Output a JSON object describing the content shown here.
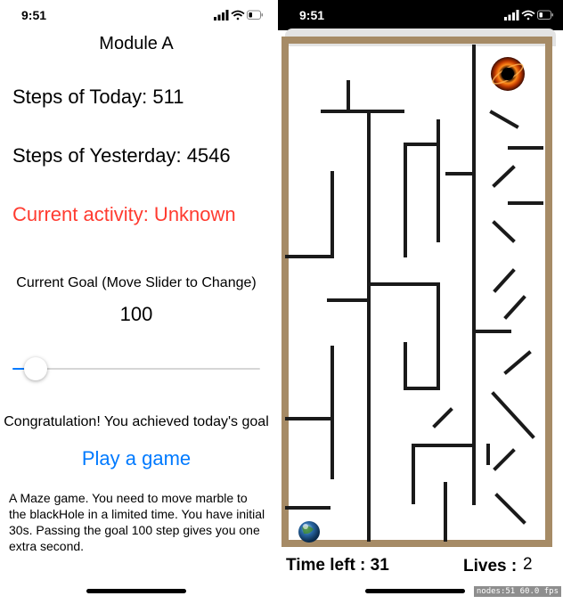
{
  "status_bar": {
    "time": "9:51"
  },
  "module": {
    "title": "Module A",
    "steps_today": "Steps of Today: 511",
    "steps_yesterday": "Steps of Yesterday: 4546",
    "current_activity": "Current activity: Unknown",
    "goal_label": "Current Goal (Move Slider to Change)",
    "goal_value": "100",
    "slider_level": 0.05,
    "congrats": "Congratulation! You achieved today's goal",
    "play_button": "Play a game",
    "description": "A Maze game. You need to move marble to the blackHole in a limited time. You have initial 30s. Passing the goal 100 step gives you one extra second."
  },
  "game": {
    "time_left_label": "Time left : ",
    "time_left_value": "31",
    "lives_label": "Lives :",
    "lives_value": "2",
    "debug_stats": "nodes:51  60.0 fps"
  },
  "colors": {
    "accent": "#007aff",
    "warning": "#ff3b30",
    "maze_border": "#a68b66",
    "maze_wall": "#1a1a1a"
  },
  "icons": [
    "signal-icon",
    "wifi-icon",
    "battery-icon",
    "black-hole-icon",
    "marble-icon"
  ]
}
